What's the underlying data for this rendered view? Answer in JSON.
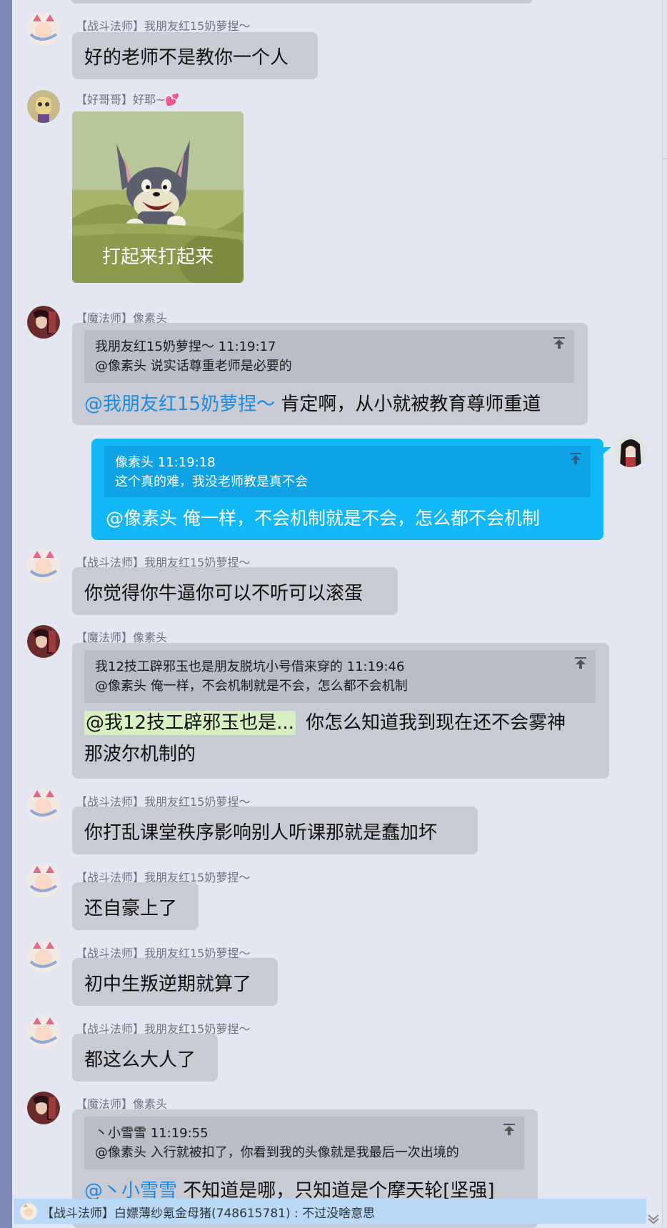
{
  "messages": [
    {
      "id": "m1",
      "avatar": "cat-avatar",
      "name": "【战斗法师】我朋友红15奶萝捏～",
      "text": "好的老师不是教你一个人"
    },
    {
      "id": "m2",
      "avatar": "dog-avatar",
      "name": "【好哥哥】好耶~💕",
      "sticker_caption": "打起来打起来"
    },
    {
      "id": "m3",
      "avatar": "girl-avatar",
      "name": "【魔法师】像素头",
      "quote_title": "我朋友红15奶萝捏～   11:19:17",
      "quote_text": "@像素头 说实话尊重老师是必要的",
      "mention": "@我朋友红15奶萝捏～",
      "text": " 肯定啊，从小就被教育尊师重道"
    },
    {
      "id": "m4",
      "self": true,
      "avatar": "self-avatar",
      "quote_title": "像素头   11:19:18",
      "quote_text": "这个真的难，我没老师教是真不会",
      "text": "@像素头 俺一样，不会机制就是不会，怎么都不会机制"
    },
    {
      "id": "m5",
      "avatar": "cat-avatar",
      "name": "【战斗法师】我朋友红15奶萝捏～",
      "text": "你觉得你牛逼你可以不听可以滚蛋"
    },
    {
      "id": "m6",
      "avatar": "girl-avatar",
      "name": "【魔法师】像素头",
      "quote_title": "我12技工辟邪玉也是朋友脱坑小号借来穿的   11:19:46",
      "quote_text": "@像素头 俺一样，不会机制就是不会，怎么都不会机制",
      "mention": "@我12技工辟邪玉也是...",
      "text_line1": "你怎么知道我到现在还不会雾神",
      "text_line2": "那波尔机制的"
    },
    {
      "id": "m7",
      "avatar": "cat-avatar",
      "name": "【战斗法师】我朋友红15奶萝捏～",
      "text": "你打乱课堂秩序影响别人听课那就是蠢加坏"
    },
    {
      "id": "m8",
      "avatar": "cat-avatar",
      "name": "【战斗法师】我朋友红15奶萝捏～",
      "text": "还自豪上了"
    },
    {
      "id": "m9",
      "avatar": "cat-avatar",
      "name": "【战斗法师】我朋友红15奶萝捏～",
      "text": "初中生叛逆期就算了"
    },
    {
      "id": "m10",
      "avatar": "cat-avatar",
      "name": "【战斗法师】我朋友红15奶萝捏～",
      "text": "都这么大人了"
    },
    {
      "id": "m11",
      "avatar": "girl-avatar",
      "name": "【魔法师】像素头",
      "quote_title": "丶小雪雪   11:19:55",
      "quote_text": "@像素头 入行就被扣了，你看到我的头像就是我最后一次出境的",
      "mention": "@丶小雪雪",
      "text": " 不知道是哪，只知道是个摩天轮[坚强]"
    }
  ],
  "footer": {
    "preview_text": "【战斗法师】白嫖薄纱氪金母猪(748615781) : 不过没啥意思"
  },
  "colors": {
    "bubble": "#c8cbd4",
    "self_bubble": "#12b7f5",
    "mention": "#1b8ae0",
    "highlight": "#d6f0c2",
    "footer": "#b9d9f7"
  }
}
